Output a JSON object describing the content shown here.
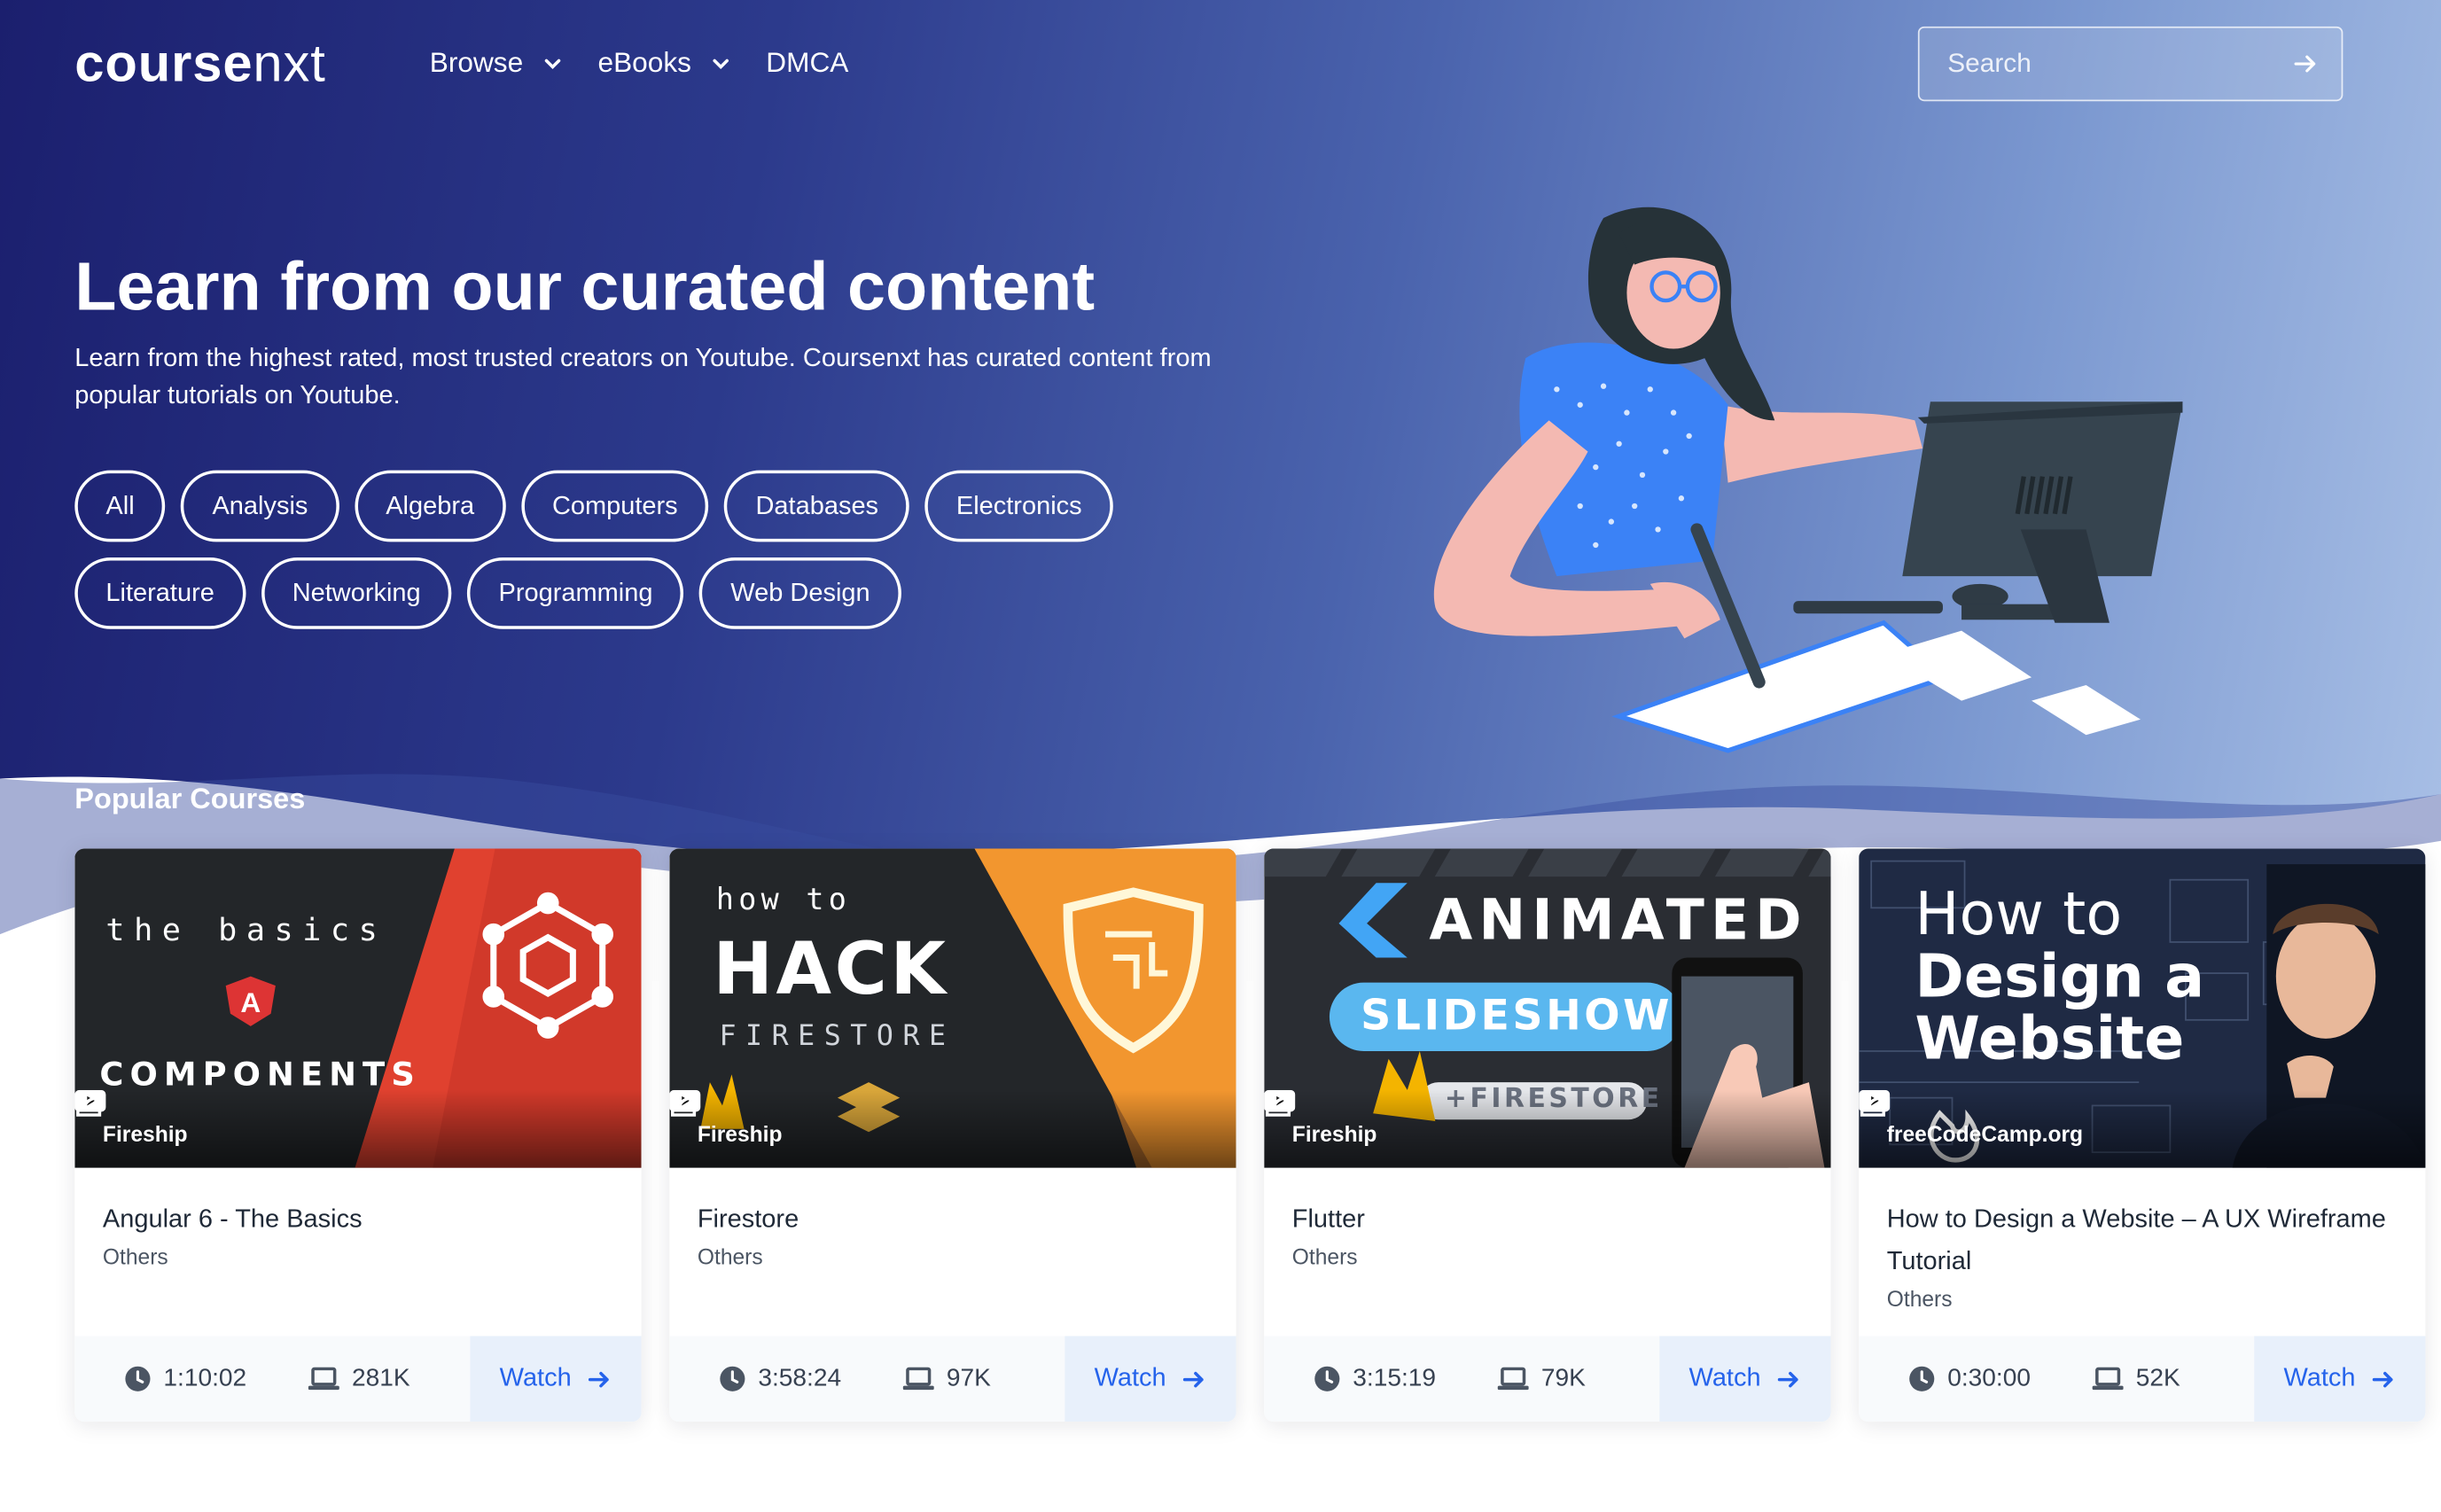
{
  "brand": {
    "logo_bold": "course",
    "logo_light": "nxt"
  },
  "nav": {
    "items": [
      {
        "label": "Browse",
        "has_dropdown": true
      },
      {
        "label": "eBooks",
        "has_dropdown": true
      },
      {
        "label": "DMCA",
        "has_dropdown": false
      }
    ]
  },
  "search": {
    "placeholder": "Search",
    "value": ""
  },
  "hero": {
    "title": "Learn from our curated content",
    "subtitle": "Learn from the highest rated, most trusted creators on Youtube. Coursenxt has curated content from popular tutorials on Youtube.",
    "categories": [
      "All",
      "Analysis",
      "Algebra",
      "Computers",
      "Databases",
      "Electronics",
      "Literature",
      "Networking",
      "Programming",
      "Web Design"
    ]
  },
  "popular": {
    "title": "Popular Courses",
    "courses": [
      {
        "title": "Angular 6 - The Basics",
        "category": "Others",
        "channel": "Fireship",
        "duration": "1:10:02",
        "views": "281K",
        "watch_label": "Watch",
        "thumb_text": [
          "the basics",
          "COMPONENTS"
        ]
      },
      {
        "title": "Firestore",
        "category": "Others",
        "channel": "Fireship",
        "duration": "3:58:24",
        "views": "97K",
        "watch_label": "Watch",
        "thumb_text": [
          "how to",
          "HACK",
          "FIRESTORE"
        ]
      },
      {
        "title": "Flutter",
        "category": "Others",
        "channel": "Fireship",
        "duration": "3:15:19",
        "views": "79K",
        "watch_label": "Watch",
        "thumb_text": [
          "ANIMATED",
          "SLIDESHOW",
          "+FIRESTORE"
        ]
      },
      {
        "title": "How to Design a Website – A UX Wireframe Tutorial",
        "category": "Others",
        "channel": "freeCodeCamp.org",
        "duration": "0:30:00",
        "views": "52K",
        "watch_label": "Watch",
        "thumb_text": [
          "How to",
          "Design a",
          "Website"
        ]
      }
    ]
  },
  "colors": {
    "accent": "#2563eb",
    "hero_dark": "#1b1f6e",
    "hero_light": "#a9c0e6"
  }
}
